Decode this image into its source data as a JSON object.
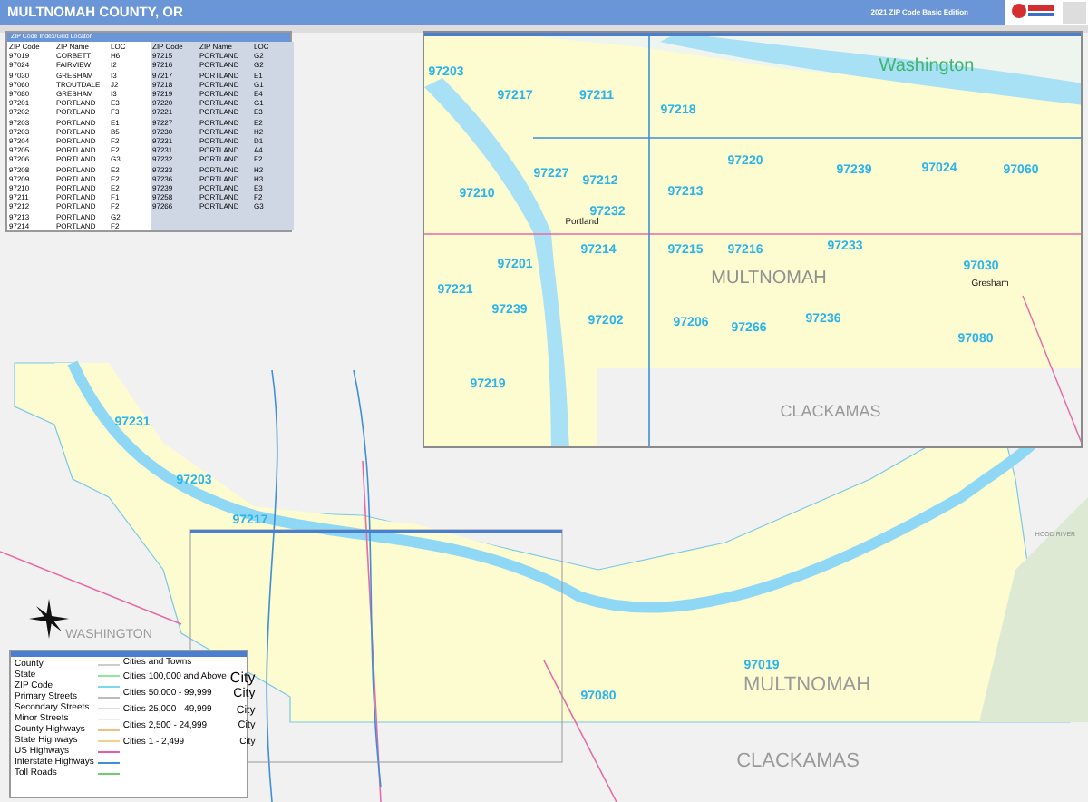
{
  "header": {
    "title": "MULTNOMAH COUNTY, OR",
    "edition": "2021 ZIP Code Basic Edition"
  },
  "zip_table": {
    "title": "ZIP Code Index/Grid Locator",
    "columns": [
      "ZIP Code",
      "ZIP Name",
      "LOC",
      "ZIP Code",
      "ZIP Name",
      "LOC"
    ],
    "rows": [
      [
        "97019",
        "CORBETT",
        "H6",
        "97215",
        "PORTLAND",
        "G2"
      ],
      [
        "97024",
        "FAIRVIEW",
        "I2",
        "97216",
        "PORTLAND",
        "G2"
      ],
      [
        "97030",
        "GRESHAM",
        "I3",
        "97217",
        "PORTLAND",
        "E1"
      ],
      [
        "97060",
        "TROUTDALE",
        "J2",
        "97218",
        "PORTLAND",
        "G1"
      ],
      [
        "97080",
        "GRESHAM",
        "I3",
        "97219",
        "PORTLAND",
        "E4"
      ],
      [
        "97201",
        "PORTLAND",
        "E3",
        "97220",
        "PORTLAND",
        "G1"
      ],
      [
        "97202",
        "PORTLAND",
        "F3",
        "97221",
        "PORTLAND",
        "E3"
      ],
      [
        "97203",
        "PORTLAND",
        "E1",
        "97227",
        "PORTLAND",
        "E2"
      ],
      [
        "97203",
        "PORTLAND",
        "B5",
        "97230",
        "PORTLAND",
        "H2"
      ],
      [
        "97204",
        "PORTLAND",
        "F2",
        "97231",
        "PORTLAND",
        "D1"
      ],
      [
        "97205",
        "PORTLAND",
        "E2",
        "97231",
        "PORTLAND",
        "A4"
      ],
      [
        "97206",
        "PORTLAND",
        "G3",
        "97232",
        "PORTLAND",
        "F2"
      ],
      [
        "97208",
        "PORTLAND",
        "E2",
        "97233",
        "PORTLAND",
        "H2"
      ],
      [
        "97209",
        "PORTLAND",
        "E2",
        "97236",
        "PORTLAND",
        "H3"
      ],
      [
        "97210",
        "PORTLAND",
        "E2",
        "97239",
        "PORTLAND",
        "E3"
      ],
      [
        "97211",
        "PORTLAND",
        "F1",
        "97258",
        "PORTLAND",
        "F2"
      ],
      [
        "97212",
        "PORTLAND",
        "F2",
        "97266",
        "PORTLAND",
        "G3"
      ],
      [
        "97213",
        "PORTLAND",
        "G2"
      ],
      [
        "97214",
        "PORTLAND",
        "F2"
      ]
    ]
  },
  "inset_map": {
    "labels": [
      {
        "kind": "state",
        "text": "Washington"
      },
      {
        "kind": "zip",
        "text": "97203"
      },
      {
        "kind": "zip",
        "text": "97217"
      },
      {
        "kind": "zip",
        "text": "97211"
      },
      {
        "kind": "zip",
        "text": "97218"
      },
      {
        "kind": "zip",
        "text": "97220"
      },
      {
        "kind": "zip",
        "text": "97239"
      },
      {
        "kind": "zip",
        "text": "97024"
      },
      {
        "kind": "zip",
        "text": "97060"
      },
      {
        "kind": "zip",
        "text": "97210"
      },
      {
        "kind": "zip",
        "text": "97227"
      },
      {
        "kind": "zip",
        "text": "97212"
      },
      {
        "kind": "zip",
        "text": "97213"
      },
      {
        "kind": "zip",
        "text": "97232"
      },
      {
        "kind": "city",
        "text": "Portland"
      },
      {
        "kind": "zip",
        "text": "97214"
      },
      {
        "kind": "zip",
        "text": "97215"
      },
      {
        "kind": "zip",
        "text": "97216"
      },
      {
        "kind": "county",
        "text": "MULTNOMAH"
      },
      {
        "kind": "zip",
        "text": "97233"
      },
      {
        "kind": "zip",
        "text": "97030"
      },
      {
        "kind": "city",
        "text": "Gresham"
      },
      {
        "kind": "zip",
        "text": "97201"
      },
      {
        "kind": "zip",
        "text": "97221"
      },
      {
        "kind": "zip",
        "text": "97239"
      },
      {
        "kind": "zip",
        "text": "97202"
      },
      {
        "kind": "zip",
        "text": "97206"
      },
      {
        "kind": "zip",
        "text": "97266"
      },
      {
        "kind": "zip",
        "text": "97236"
      },
      {
        "kind": "zip",
        "text": "97080"
      },
      {
        "kind": "zip",
        "text": "97219"
      },
      {
        "kind": "county",
        "text": "CLACKAMAS"
      }
    ]
  },
  "main_map": {
    "labels": [
      {
        "kind": "zip",
        "text": "97231"
      },
      {
        "kind": "zip",
        "text": "97203"
      },
      {
        "kind": "zip",
        "text": "97217"
      },
      {
        "kind": "county",
        "text": "HOOD RIVER"
      },
      {
        "kind": "zip",
        "text": "97019"
      },
      {
        "kind": "zip",
        "text": "97080"
      },
      {
        "kind": "county",
        "text": "MULTNOMAH"
      },
      {
        "kind": "county",
        "text": "CLACKAMAS"
      },
      {
        "kind": "county",
        "text": "WASHINGTON"
      }
    ]
  },
  "legend": {
    "items": [
      "County",
      "State",
      "ZIP Code",
      "Primary Streets",
      "Secondary Streets",
      "Minor Streets",
      "County Highways",
      "State Highways",
      "US Highways",
      "Interstate Highways",
      "Toll Roads"
    ],
    "cities_title": "Cities and Towns",
    "cities": [
      {
        "label": "Cities 100,000 and Above",
        "sample": "City"
      },
      {
        "label": "Cities 50,000 - 99,999",
        "sample": "City"
      },
      {
        "label": "Cities 25,000 - 49,999",
        "sample": "City"
      },
      {
        "label": "Cities 2,500 - 24,999",
        "sample": "City"
      },
      {
        "label": "Cities 1 - 2,499",
        "sample": "City"
      }
    ]
  }
}
